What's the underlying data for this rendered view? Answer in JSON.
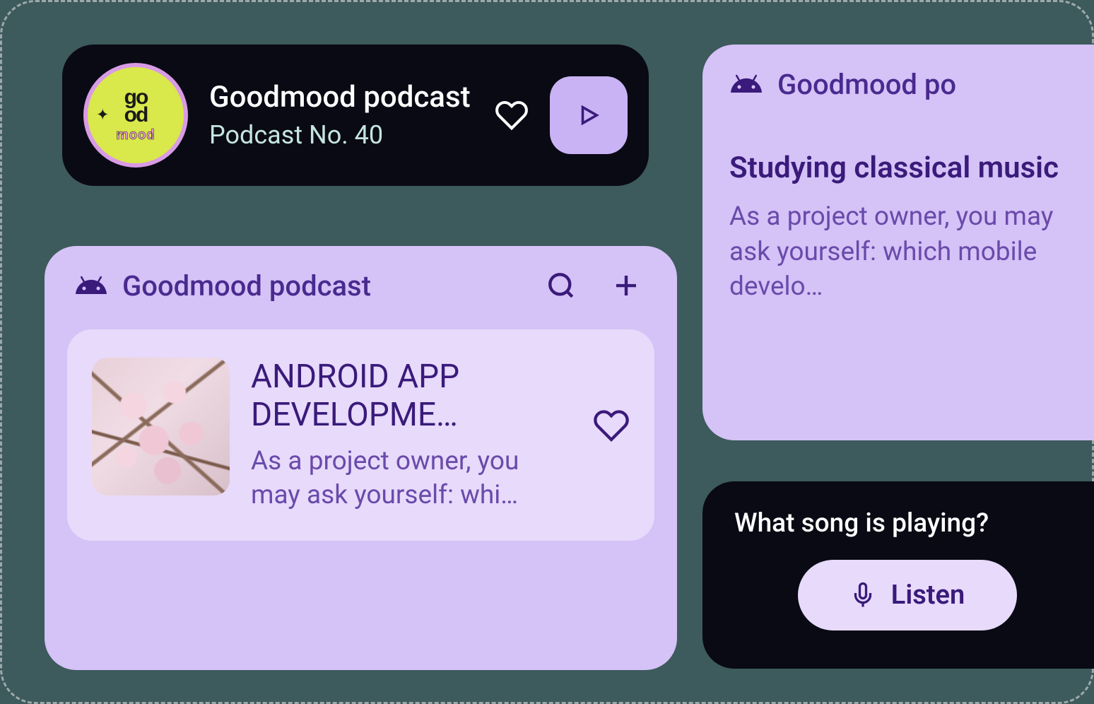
{
  "player": {
    "title": "Goodmood podcast",
    "subtitle": "Podcast No. 40",
    "art_text1": "go\nod",
    "art_text2": "mood"
  },
  "main": {
    "title": "Goodmood podcast",
    "episode": {
      "title": "ANDROID APP DEVELOPME…",
      "description": "As a project owner, you may ask yourself: whi…"
    }
  },
  "side": {
    "title": "Goodmood po",
    "episode": {
      "title": "Studying classical music",
      "description": "As a project owner, you may ask yourself: which mobile develo…"
    }
  },
  "listen": {
    "title": "What song is playing?",
    "button_label": "Listen"
  },
  "colors": {
    "dark": "#0a0a14",
    "lavender": "#d5c2f7",
    "lavender_light": "#e7dafb",
    "purple_text": "#3a1a7a",
    "purple_medium": "#4a2a8f"
  }
}
